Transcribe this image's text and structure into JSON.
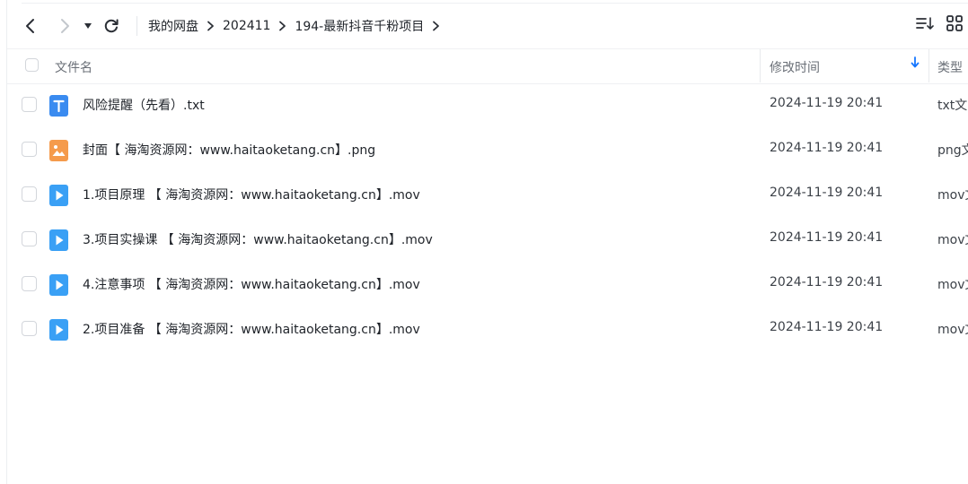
{
  "toolbar": {
    "back_icon": "chevron-left-icon",
    "forward_icon": "chevron-right-icon",
    "history_icon": "caret-down-icon",
    "refresh_icon": "refresh-icon",
    "sort_view_icon": "sort-list-icon",
    "grid_view_icon": "grid-icon"
  },
  "breadcrumb": [
    "我的网盘",
    "202411",
    "194-最新抖音千粉项目"
  ],
  "columns": {
    "name": "文件名",
    "modified": "修改时间",
    "type": "类型",
    "sort_icon": "arrow-down-icon",
    "sort_color": "#1677ff"
  },
  "colors": {
    "txt_icon": "#3a8bf0",
    "image_icon": "#f59b4c",
    "video_icon": "#3aa0f5"
  },
  "files": [
    {
      "name": "风险提醒（先看）.txt",
      "modified": "2024-11-19 20:41",
      "type": "txt文",
      "icon": "txt-file-icon",
      "kind": "txt"
    },
    {
      "name": "封面【 海淘资源网：www.haitaoketang.cn】.png",
      "modified": "2024-11-19 20:41",
      "type": "png文",
      "icon": "image-file-icon",
      "kind": "img"
    },
    {
      "name": "1.项目原理 【 海淘资源网：www.haitaoketang.cn】.mov",
      "modified": "2024-11-19 20:41",
      "type": "mov文",
      "icon": "video-file-icon",
      "kind": "video"
    },
    {
      "name": "3.项目实操课 【 海淘资源网：www.haitaoketang.cn】.mov",
      "modified": "2024-11-19 20:41",
      "type": "mov文",
      "icon": "video-file-icon",
      "kind": "video"
    },
    {
      "name": "4.注意事项 【 海淘资源网：www.haitaoketang.cn】.mov",
      "modified": "2024-11-19 20:41",
      "type": "mov文",
      "icon": "video-file-icon",
      "kind": "video"
    },
    {
      "name": "2.项目准备 【 海淘资源网：www.haitaoketang.cn】.mov",
      "modified": "2024-11-19 20:41",
      "type": "mov文",
      "icon": "video-file-icon",
      "kind": "video"
    }
  ]
}
